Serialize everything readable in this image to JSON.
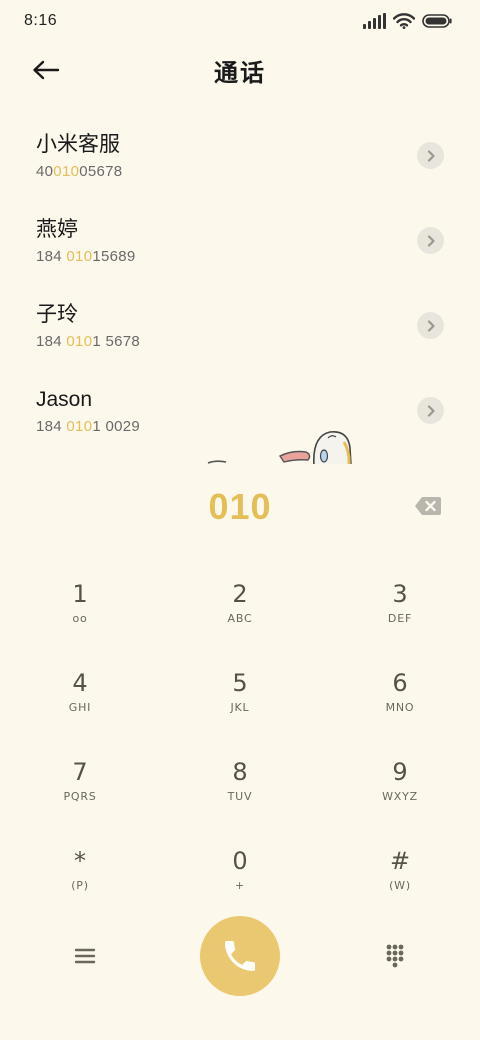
{
  "status_bar": {
    "time": "8:16",
    "battery_color": "#333333"
  },
  "header": {
    "title": "通话"
  },
  "results": [
    {
      "name": "小米客服",
      "number_parts": [
        "40",
        "010",
        "05678"
      ]
    },
    {
      "name": "燕婷",
      "number_parts": [
        "184 ",
        "010",
        "15689"
      ]
    },
    {
      "name": "子玲",
      "number_parts": [
        "184 ",
        "010",
        "1 5678"
      ]
    },
    {
      "name": "Jason",
      "number_parts": [
        "184 ",
        "010",
        "1 0029"
      ]
    }
  ],
  "dialer": {
    "input": "010"
  },
  "keypad": [
    {
      "digit": "1",
      "letters": "oo"
    },
    {
      "digit": "2",
      "letters": "ABC"
    },
    {
      "digit": "3",
      "letters": "DEF"
    },
    {
      "digit": "4",
      "letters": "GHI"
    },
    {
      "digit": "5",
      "letters": "JKL"
    },
    {
      "digit": "6",
      "letters": "MNO"
    },
    {
      "digit": "7",
      "letters": "PQRS"
    },
    {
      "digit": "8",
      "letters": "TUV"
    },
    {
      "digit": "9",
      "letters": "WXYZ"
    },
    {
      "digit": "*",
      "letters": "(P)"
    },
    {
      "digit": "0",
      "letters": "+"
    },
    {
      "digit": "#",
      "letters": "(W)"
    }
  ],
  "colors": {
    "accent": "#e5be58",
    "call_button": "#eac771",
    "background": "#fcf8ec"
  },
  "icons": {
    "back": "arrow-left-icon",
    "chevron": "chevron-right-icon",
    "backspace": "backspace-icon",
    "call": "phone-icon",
    "menu": "menu-icon",
    "dialpad": "dialpad-icon"
  }
}
